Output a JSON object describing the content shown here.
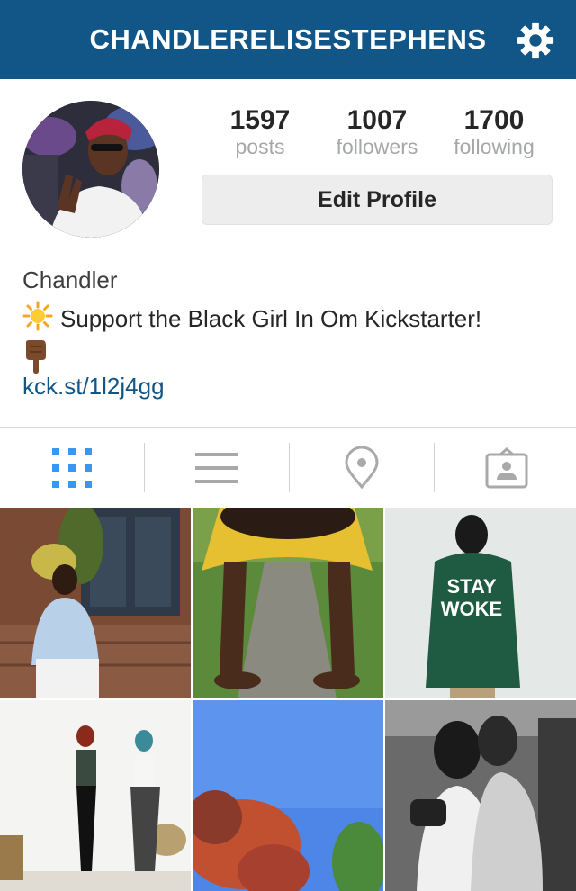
{
  "header": {
    "username": "CHANDLERELISESTEPHENS",
    "settings_icon": "gear-icon",
    "bg_color": "#125688"
  },
  "profile": {
    "stats": [
      {
        "value": "1597",
        "label": "posts"
      },
      {
        "value": "1007",
        "label": "followers"
      },
      {
        "value": "1700",
        "label": "following"
      }
    ],
    "edit_label": "Edit Profile",
    "name": "Chandler",
    "bio": "Support the Black Girl In Om Kickstarter!",
    "bio_icons": [
      "sun-emoji",
      "pointing-down-emoji"
    ],
    "link": "kck.st/1l2j4gg",
    "link_color": "#125688"
  },
  "tabs": [
    {
      "icon": "grid-icon",
      "active": true,
      "active_color": "#3897f0"
    },
    {
      "icon": "list-icon",
      "active": false
    },
    {
      "icon": "location-pin-icon",
      "active": false
    },
    {
      "icon": "tagged-photos-icon",
      "active": false
    }
  ]
}
